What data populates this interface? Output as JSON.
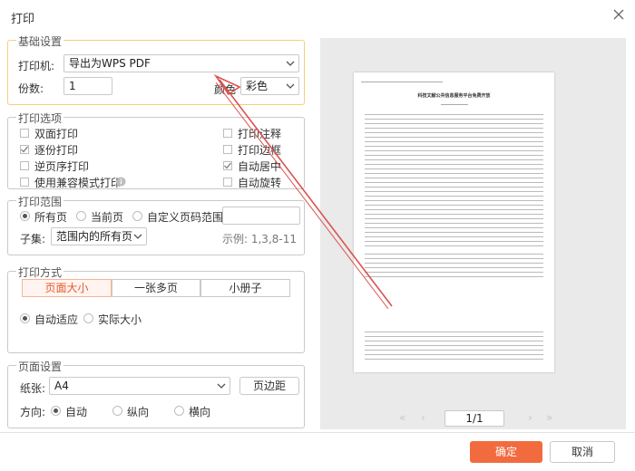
{
  "dialog": {
    "title": "打印"
  },
  "basic": {
    "title": "基础设置",
    "printer_label": "打印机:",
    "printer_value": "导出为WPS PDF",
    "copies_label": "份数:",
    "copies_value": "1",
    "color_label": "颜色",
    "color_value": "彩色"
  },
  "options": {
    "title": "打印选项",
    "duplex": "双面打印",
    "collate": "逐份打印",
    "reverse": "逆页序打印",
    "compat": "使用兼容模式打印",
    "annotations": "打印注释",
    "borders": "打印边框",
    "auto_center": "自动居中",
    "auto_rotate": "自动旋转"
  },
  "range": {
    "title": "打印范围",
    "all": "所有页",
    "current": "当前页",
    "custom": "自定义页码范围",
    "custom_value": "",
    "subset_label": "子集:",
    "subset_value": "范围内的所有页",
    "example": "示例: 1,3,8-11"
  },
  "mode": {
    "title": "打印方式",
    "tabs": [
      "页面大小",
      "一张多页",
      "小册子"
    ],
    "fit": "自动适应",
    "actual": "实际大小"
  },
  "page": {
    "title": "页面设置",
    "paper_label": "纸张:",
    "paper_value": "A4",
    "margins_btn": "页边距",
    "orientation_label": "方向:",
    "auto": "自动",
    "portrait": "纵向",
    "landscape": "横向"
  },
  "preview": {
    "doc_title": "科技文献公共信息服务平台免费开放",
    "page_indicator": "1/1"
  },
  "footer": {
    "ok": "确定",
    "cancel": "取消"
  },
  "colors": {
    "accent": "#f26b3f",
    "annotation_arrow": "#d9534f",
    "focus_border": "#f0d27a"
  }
}
